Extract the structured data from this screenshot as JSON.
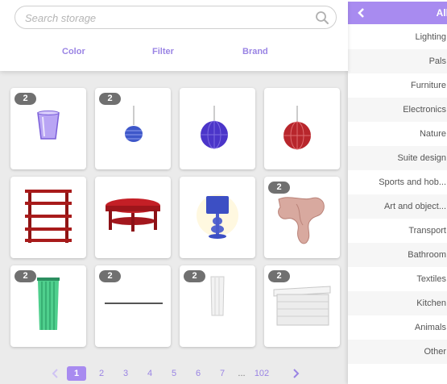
{
  "search": {
    "placeholder": "Search storage",
    "value": ""
  },
  "tabs": [
    "Color",
    "Filter",
    "Brand"
  ],
  "items": [
    {
      "name": "glass-cup",
      "badge": "2"
    },
    {
      "name": "blue-pendant-lamp",
      "badge": "2"
    },
    {
      "name": "purple-globe-lamp",
      "badge": ""
    },
    {
      "name": "red-globe-lamp",
      "badge": ""
    },
    {
      "name": "red-shelf",
      "badge": ""
    },
    {
      "name": "red-coffee-table",
      "badge": ""
    },
    {
      "name": "blue-table-lamp",
      "badge": ""
    },
    {
      "name": "pink-scarf",
      "badge": "2"
    },
    {
      "name": "green-curtain",
      "badge": "2"
    },
    {
      "name": "rod",
      "badge": "2"
    },
    {
      "name": "white-curtain",
      "badge": "2"
    },
    {
      "name": "white-chest",
      "badge": "2"
    }
  ],
  "pagination": {
    "current": "1",
    "pages": [
      "1",
      "2",
      "3",
      "4",
      "5",
      "6",
      "7"
    ],
    "ellipsis": "...",
    "last": "102"
  },
  "sidebar": {
    "title": "All",
    "categories": [
      "Lighting",
      "Pals",
      "Furniture",
      "Electronics",
      "Nature",
      "Suite design",
      "Sports and hob...",
      "Art and object...",
      "Transport",
      "Bathroom",
      "Textiles",
      "Kitchen",
      "Animals",
      "Other"
    ]
  },
  "colors": {
    "accent": "#a88bf0",
    "tab_text": "#9a84e4",
    "badge": "#707070"
  }
}
